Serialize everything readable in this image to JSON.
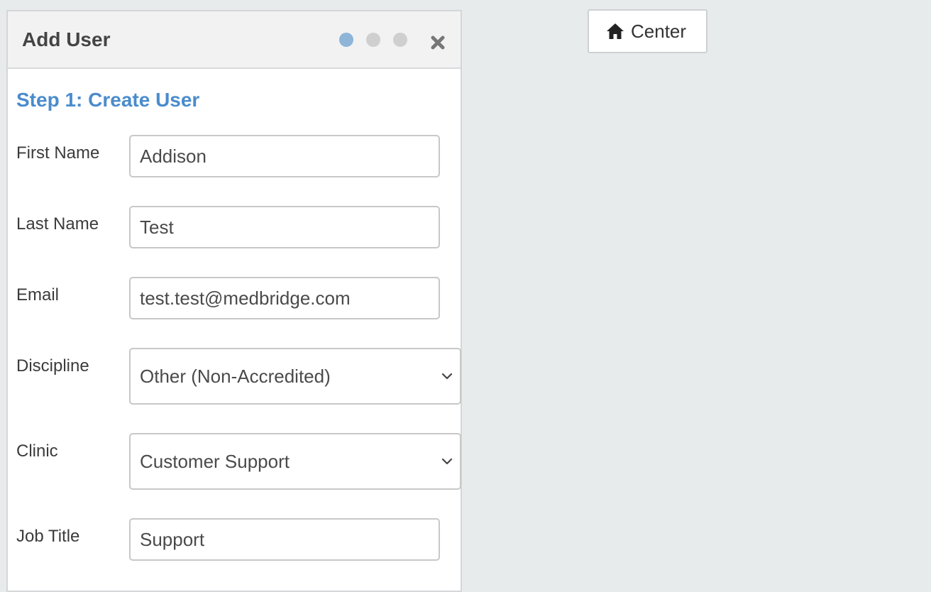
{
  "dialog": {
    "title": "Add User",
    "close_icon": "close-icon",
    "steps": {
      "total": 3,
      "current": 1
    },
    "step_title": "Step 1: Create User"
  },
  "form": {
    "first_name": {
      "label": "First Name",
      "value": "Addison"
    },
    "last_name": {
      "label": "Last Name",
      "value": "Test"
    },
    "email": {
      "label": "Email",
      "value": "test.test@medbridge.com"
    },
    "discipline": {
      "label": "Discipline",
      "selected": "Other (Non-Accredited)"
    },
    "clinic": {
      "label": "Clinic",
      "selected": "Customer Support"
    },
    "job_title": {
      "label": "Job Title",
      "value": "Support"
    }
  },
  "toolbar": {
    "center_label": "Center",
    "center_icon": "home-icon"
  },
  "colors": {
    "background": "#e8ebec",
    "accent": "#4a8ccc",
    "active_step": "#8eb4d8",
    "inactive_step": "#cfcfcf"
  }
}
